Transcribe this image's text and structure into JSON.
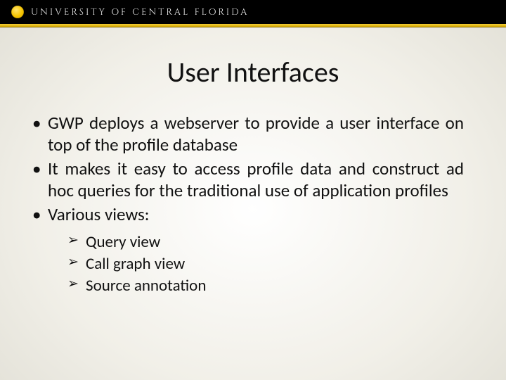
{
  "header": {
    "wordmark": "UNIVERSITY OF CENTRAL FLORIDA"
  },
  "title": "User Interfaces",
  "bullets": [
    "GWP deploys a webserver to provide a user interface on top of the profile database",
    "It makes it easy to access profile data and construct ad hoc queries for the traditional use of application profiles",
    "Various views:"
  ],
  "sub_bullets": [
    "Query view",
    "Call graph view",
    "Source annotation"
  ]
}
